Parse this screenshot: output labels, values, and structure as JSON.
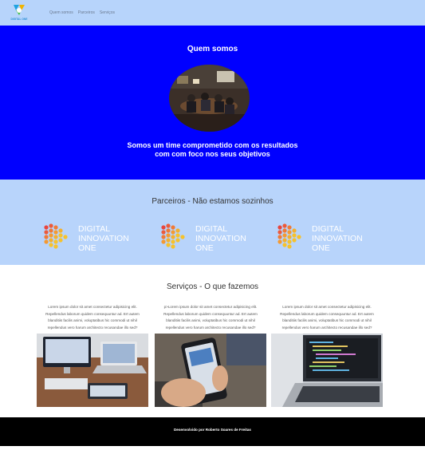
{
  "header": {
    "logo_caption": "DIGITAL ONE",
    "nav": [
      "Quem somos",
      "Parceiros",
      "Serviços"
    ]
  },
  "about": {
    "title": "Quem somos",
    "text_line1": "Somos um time comprometido com os resultados",
    "text_line2": "com com foco nos seus objetivos"
  },
  "partners": {
    "title": "Parceiros - Não estamos sozinhos",
    "logos": [
      {
        "line1": "DIGITAL",
        "line2": "INNOVATION",
        "line3": "ONE"
      },
      {
        "line1": "DIGITAL",
        "line2": "INNOVATION",
        "line3": "ONE"
      },
      {
        "line1": "DIGITAL",
        "line2": "INNOVATION",
        "line3": "ONE"
      }
    ]
  },
  "services": {
    "title": "Serviços - O que fazemos",
    "items": [
      {
        "line1": "Lorem ipsum dolor sit amet consectetur adipisicing elit.",
        "line2": "Repellendus laborum quidem consequuntur ad. Ert autem",
        "line3": "blanditiis facilis animi, voluptatibus hic commodi ut nihil",
        "line4": "repellendus vero harum architecto recusandae illo sed?"
      },
      {
        "line1": "p>Lorem ipsum dolor sit amet consectetur adipisicing elit.",
        "line2": "Repellendus laborum quidem consequuntur ad. Ert autem",
        "line3": "blanditiis facilis animi, voluptatibus hic commodi ut nihil",
        "line4": "repellendus vero harum architecto recusandae illo sed?"
      },
      {
        "line1": "Lorem ipsum dolor sit amet consectetur adipisicing elit.",
        "line2": "Repellendus laborum quidem consequuntur ad. Ert autem",
        "line3": "blanditiis facilis animi, voluptatibus hic commodi ut nihil",
        "line4": "repellendus vero harum architecto recusandae illo sed?"
      }
    ]
  },
  "footer": {
    "text": "Desenvolvido por Roberto Soares de Freitas"
  },
  "colors": {
    "header_bg": "#b7d4fb",
    "about_bg": "#0000ff",
    "partners_bg": "#b8d4fb",
    "footer_bg": "#000000"
  }
}
